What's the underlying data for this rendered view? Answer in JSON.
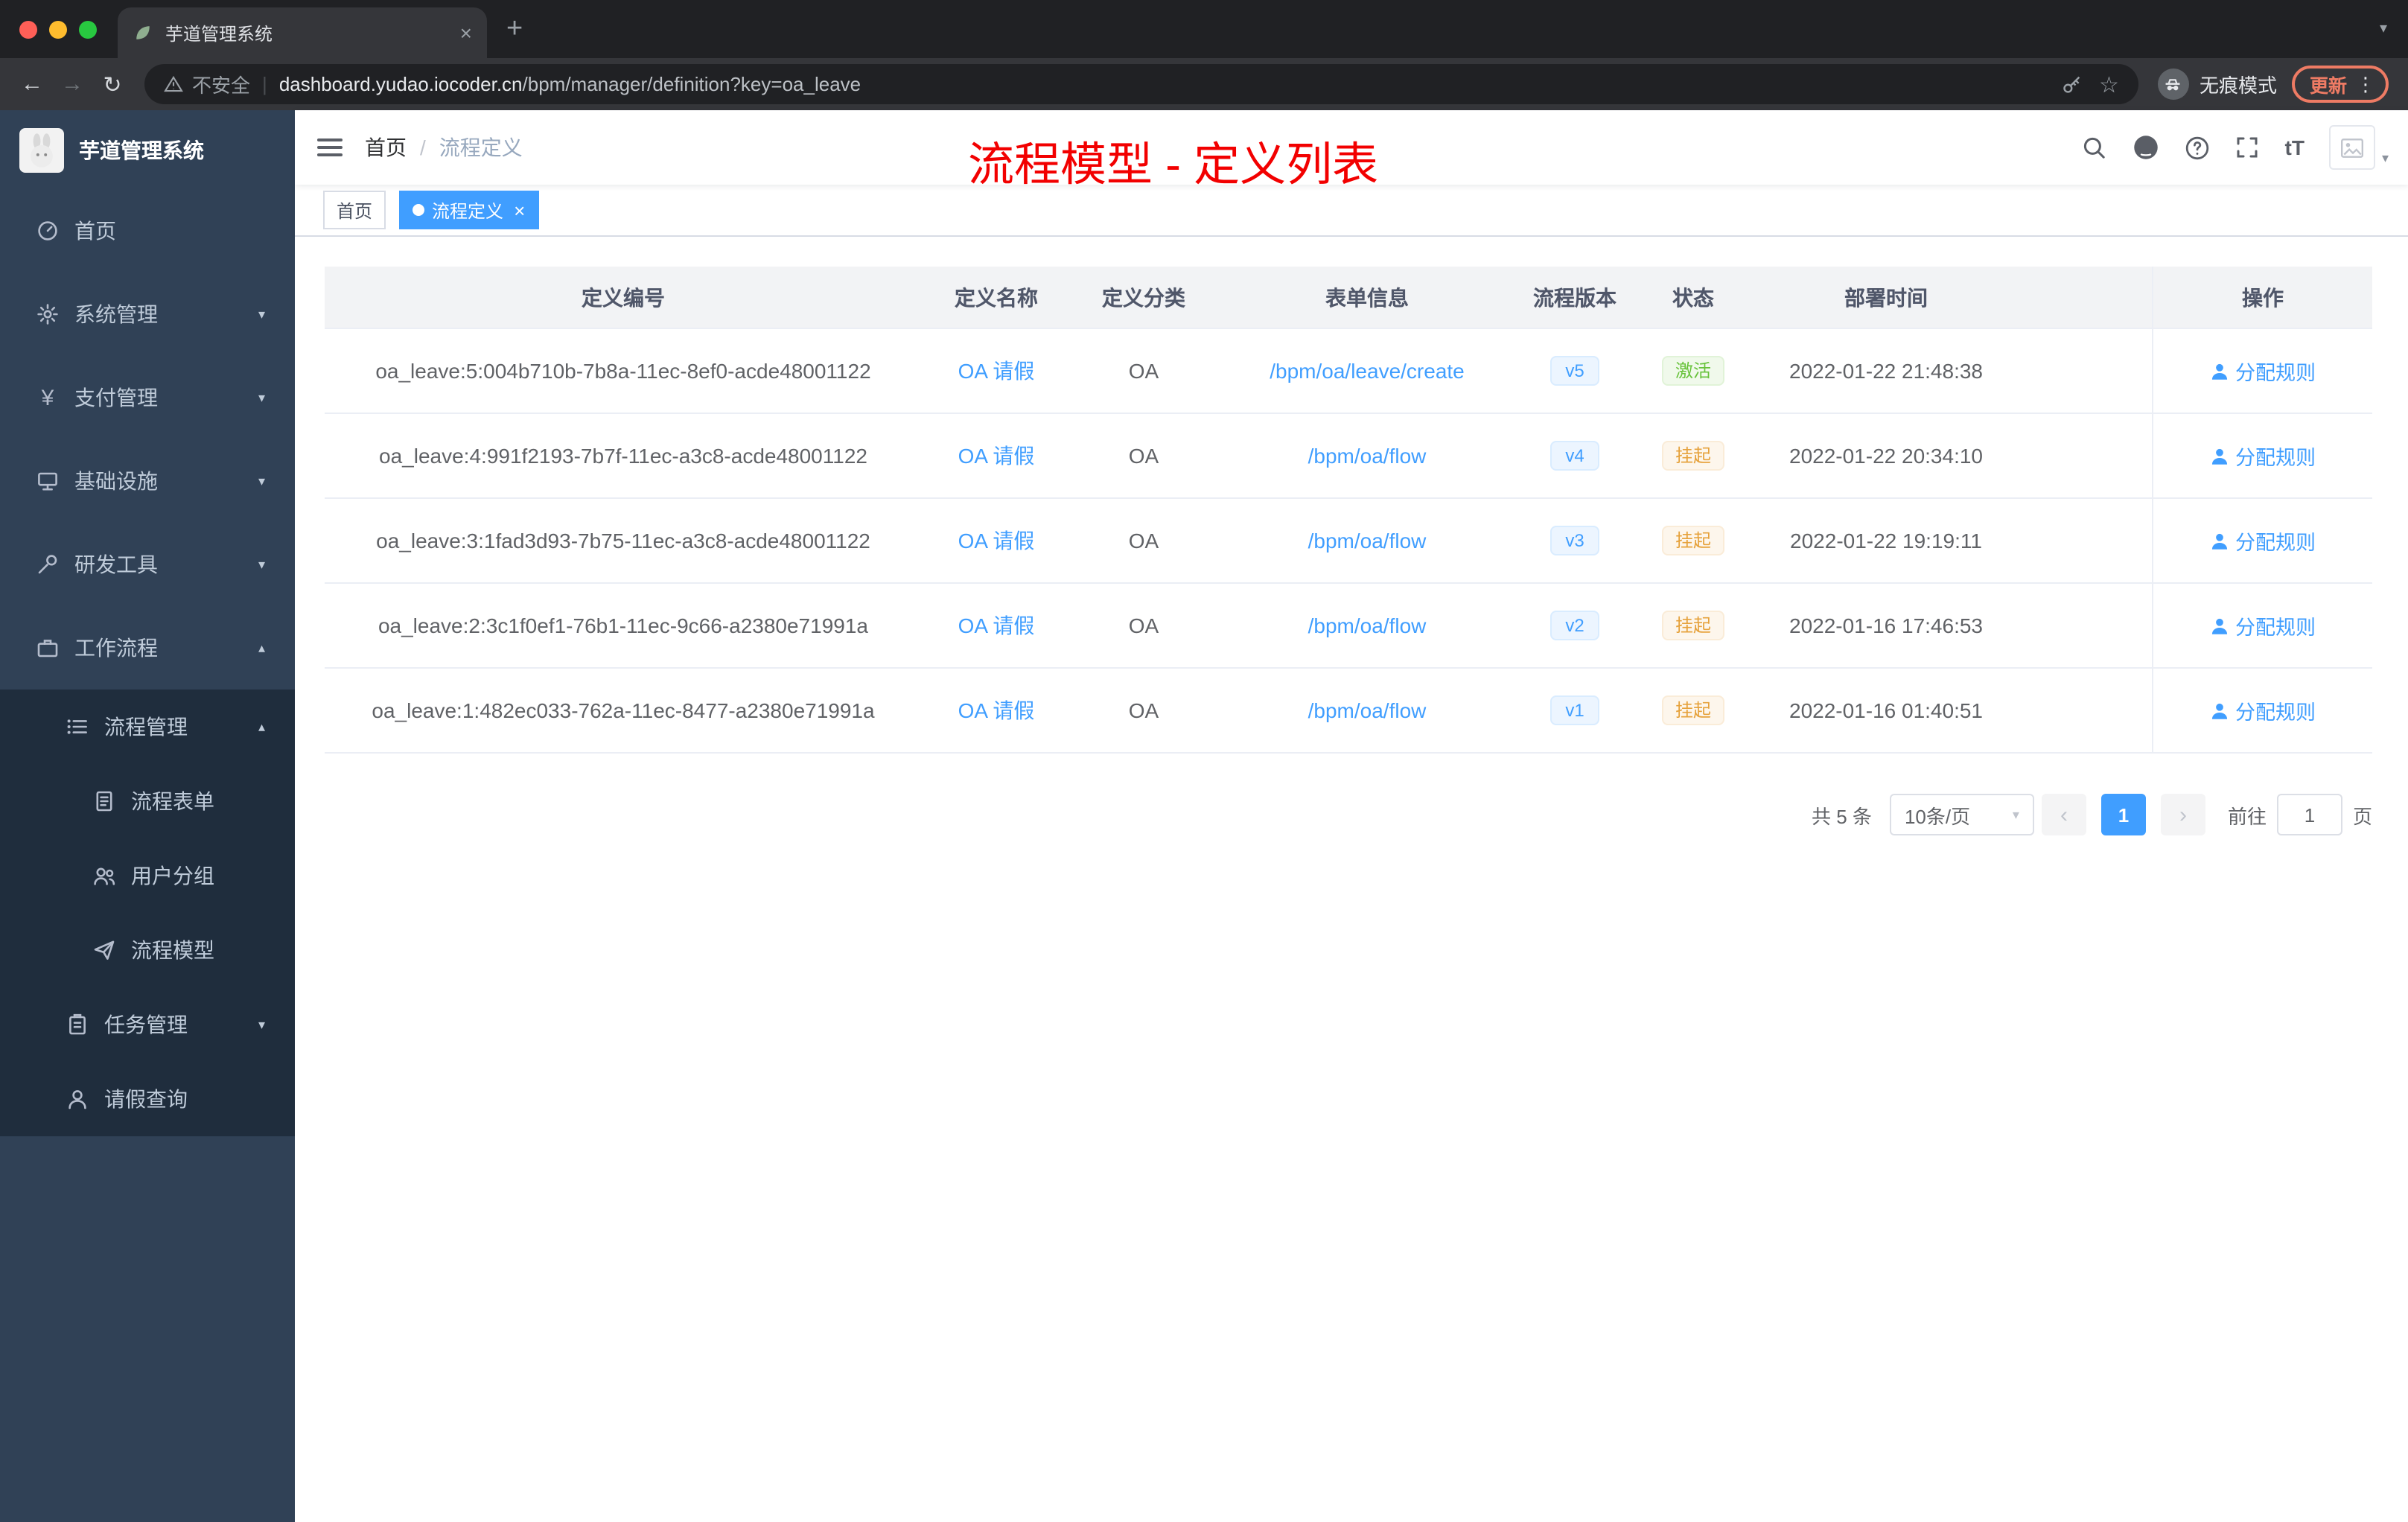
{
  "colors": {
    "primary": "#409eff",
    "status_active_text": "#67c23a",
    "status_suspend_text": "#e6a23c",
    "annotation_red": "#f20000",
    "sidebar_bg": "#304156",
    "submenu_bg": "#1f2d3d"
  },
  "icons": {
    "back": "←",
    "forward": "→",
    "refresh": "↻",
    "star": "☆",
    "kebab": "⋮",
    "close": "×",
    "plus": "+",
    "caret_down": "▾",
    "caret_up": "▴",
    "prev": "‹",
    "next": "›",
    "yen": "¥",
    "font_size": "tT"
  },
  "browser": {
    "tab_title": "芋道管理系统",
    "security_label": "不安全",
    "url_host": "dashboard.yudao.iocoder.cn",
    "url_path": "/bpm/manager/definition?key=oa_leave",
    "incognito_label": "无痕模式",
    "update_label": "更新"
  },
  "annotation": {
    "title": "流程模型 - 定义列表"
  },
  "sidebar": {
    "logo_title": "芋道管理系统",
    "items": [
      {
        "label": "首页"
      },
      {
        "label": "系统管理"
      },
      {
        "label": "支付管理"
      },
      {
        "label": "基础设施"
      },
      {
        "label": "研发工具"
      },
      {
        "label": "工作流程"
      },
      {
        "label": "流程管理"
      },
      {
        "label": "流程表单"
      },
      {
        "label": "用户分组"
      },
      {
        "label": "流程模型"
      },
      {
        "label": "任务管理"
      },
      {
        "label": "请假查询"
      }
    ]
  },
  "header": {
    "breadcrumb": {
      "home": "首页",
      "separator": "/",
      "current": "流程定义"
    }
  },
  "tags": [
    {
      "label": "首页"
    },
    {
      "label": "流程定义"
    }
  ],
  "table": {
    "columns": [
      "定义编号",
      "定义名称",
      "定义分类",
      "表单信息",
      "流程版本",
      "状态",
      "部署时间",
      "操作"
    ],
    "rows": [
      {
        "id": "oa_leave:5:004b710b-7b8a-11ec-8ef0-acde48001122",
        "name": "OA 请假",
        "category": "OA",
        "form": "/bpm/oa/leave/create",
        "version": "v5",
        "status": "激活",
        "time": "2022-01-22 21:48:38",
        "action": "分配规则"
      },
      {
        "id": "oa_leave:4:991f2193-7b7f-11ec-a3c8-acde48001122",
        "name": "OA 请假",
        "category": "OA",
        "form": "/bpm/oa/flow",
        "version": "v4",
        "status": "挂起",
        "time": "2022-01-22 20:34:10",
        "action": "分配规则"
      },
      {
        "id": "oa_leave:3:1fad3d93-7b75-11ec-a3c8-acde48001122",
        "name": "OA 请假",
        "category": "OA",
        "form": "/bpm/oa/flow",
        "version": "v3",
        "status": "挂起",
        "time": "2022-01-22 19:19:11",
        "action": "分配规则"
      },
      {
        "id": "oa_leave:2:3c1f0ef1-76b1-11ec-9c66-a2380e71991a",
        "name": "OA 请假",
        "category": "OA",
        "form": "/bpm/oa/flow",
        "version": "v2",
        "status": "挂起",
        "time": "2022-01-16 17:46:53",
        "action": "分配规则"
      },
      {
        "id": "oa_leave:1:482ec033-762a-11ec-8477-a2380e71991a",
        "name": "OA 请假",
        "category": "OA",
        "form": "/bpm/oa/flow",
        "version": "v1",
        "status": "挂起",
        "time": "2022-01-16 01:40:51",
        "action": "分配规则"
      }
    ]
  },
  "pagination": {
    "total": "共 5 条",
    "page_size": "10条/页",
    "current_page": "1",
    "goto": "前往",
    "goto_value": "1",
    "page_unit": "页"
  }
}
